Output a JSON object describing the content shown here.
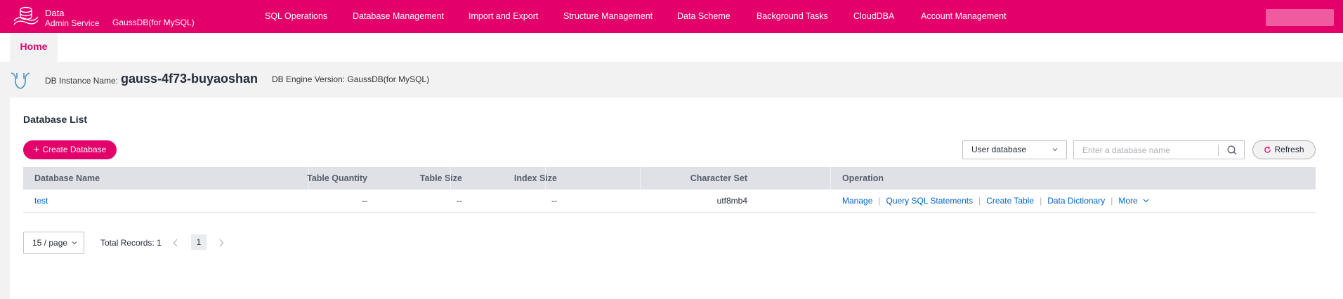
{
  "header": {
    "brand_title": "Data",
    "brand_subtitle": "Admin Service",
    "engine": "GaussDB(for MySQL)",
    "nav": [
      {
        "label": "SQL Operations"
      },
      {
        "label": "Database Management"
      },
      {
        "label": "Import and Export"
      },
      {
        "label": "Structure Management"
      },
      {
        "label": "Data Scheme"
      },
      {
        "label": "Background Tasks"
      },
      {
        "label": "CloudDBA"
      },
      {
        "label": "Account Management"
      }
    ],
    "accent_color": "#e3006b"
  },
  "tabs": [
    {
      "label": "Home",
      "active": true
    }
  ],
  "instance": {
    "name_label": "DB Instance Name:",
    "name": "gauss-4f73-buyaoshan",
    "engine_version": "DB Engine Version: GaussDB(for MySQL)"
  },
  "panel": {
    "title": "Database List",
    "create_button": "Create Database",
    "filter_select": "User database",
    "search_placeholder": "Enter a database name",
    "refresh_button": "Refresh"
  },
  "table": {
    "columns": [
      "Database Name",
      "Table Quantity",
      "Table Size",
      "Index Size",
      "Character Set",
      "Operation"
    ],
    "rows": [
      {
        "name": "test",
        "table_quantity": "--",
        "table_size": "--",
        "index_size": "--",
        "charset": "utf8mb4",
        "operations": [
          "Manage",
          "Query SQL Statements",
          "Create Table",
          "Data Dictionary",
          "More"
        ]
      }
    ]
  },
  "pagination": {
    "page_size": "15 / page",
    "total_records": "Total Records: 1",
    "current_page": "1"
  }
}
